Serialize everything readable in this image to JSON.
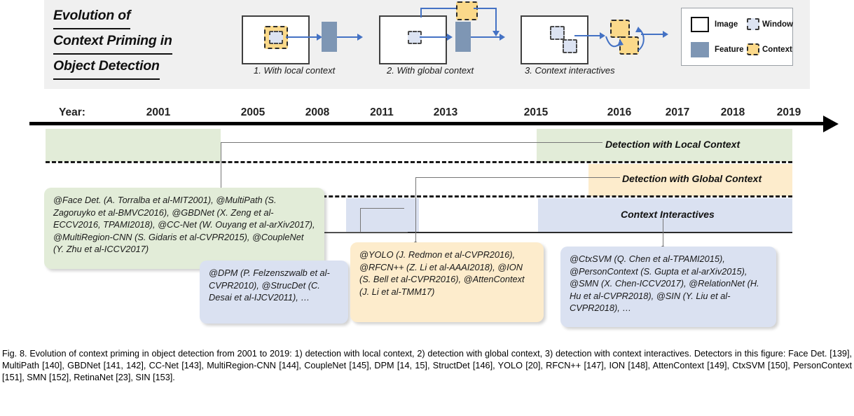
{
  "figure": {
    "title_lines": [
      "Evolution of",
      "Context Priming in",
      "Object Detection"
    ],
    "panels": [
      {
        "caption": "1. With local context"
      },
      {
        "caption": "2. With global context"
      },
      {
        "caption": "3. Context interactives"
      }
    ],
    "legend": {
      "image_label": "Image",
      "window_label": "Window",
      "feature_label": "Feature",
      "context_label": "Context"
    },
    "colors": {
      "header_strip": "#f0f0f0",
      "band_green": "#e2ecd8",
      "band_yellow": "#fdeccc",
      "band_blue": "#dae1f1",
      "feature_fill": "#7e96b4",
      "window_fill": "#dce3f2",
      "context_fill": "#fbd98a",
      "arrow_blue": "#4472c4",
      "axis_black": "#000000"
    }
  },
  "timeline": {
    "year_prefix": "Year:",
    "years": [
      "2001",
      "2005",
      "2008",
      "2011",
      "2013",
      "2015",
      "2016",
      "2017",
      "2018",
      "2019"
    ],
    "bands": [
      {
        "label": "Detection with Local Context"
      },
      {
        "label": "Detection with Global Context"
      },
      {
        "label": "Context Interactives"
      }
    ]
  },
  "callouts": {
    "local": "@Face Det. (A. Torralba et al-MIT2001), @MultiPath (S. Zagoruyko et al-BMVC2016), @GBDNet (X. Zeng et al-ECCV2016, TPAMI2018), @CC-Net (W. Ouyang et al-arXiv2017), @MultiRegion-CNN (S. Gidaris et al-CVPR2015), @CoupleNet (Y. Zhu et al-ICCV2017)",
    "dpm": "@DPM (P. Felzenszwalb et al-CVPR2010), @StrucDet (C. Desai et al-IJCV2011), …",
    "global": "@YOLO (J. Redmon et al-CVPR2016), @RFCN++ (Z. Li et al-AAAI2018), @ION (S. Bell et al-CVPR2016), @AttenContext (J. Li et al-TMM17)",
    "interactive": "@CtxSVM (Q. Chen et al-TPAMI2015), @PersonContext (S. Gupta et al-arXiv2015), @SMN (X. Chen-ICCV2017), @RelationNet (H. Hu et al-CVPR2018), @SIN (Y. Liu et al-CVPR2018), …"
  },
  "caption": {
    "text": "Fig. 8.  Evolution of context priming in object detection from 2001 to 2019: 1) detection with local context, 2) detection with global context, 3) detection with context interactives. Detectors in this figure: Face Det. [139], MultiPath [140], GBDNet [141, 142], CC-Net [143], MultiRegion-CNN [144], CoupleNet [145], DPM [14, 15], StructDet [146], YOLO [20], RFCN++ [147], ION [148], AttenContext [149], CtxSVM [150], PersonContext [151], SMN [152], RetinaNet [23], SIN [153]."
  }
}
